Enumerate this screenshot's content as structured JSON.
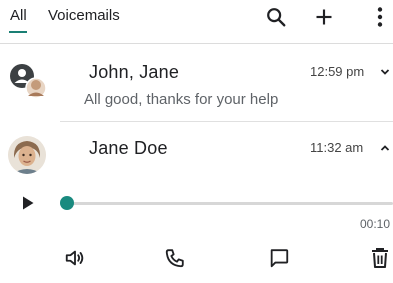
{
  "tabs": [
    {
      "label": "All",
      "selected": true
    },
    {
      "label": "Voicemails",
      "selected": false
    }
  ],
  "toolbar": {
    "icons": [
      "search-icon",
      "add-icon",
      "more-vert-icon"
    ]
  },
  "conversations": [
    {
      "name": "John, Jane",
      "time": "12:59 pm",
      "preview": "All good, thanks for your help",
      "expanded": false,
      "avatar": "group-avatar"
    },
    {
      "name": "Jane Doe",
      "time": "11:32 am",
      "expanded": true,
      "avatar": "contact-photo",
      "voicemail": {
        "progress": 0.0,
        "duration": "00:10"
      }
    }
  ],
  "actions": [
    "speaker-icon",
    "phone-icon",
    "message-icon",
    "delete-icon"
  ],
  "colors": {
    "accent": "#1a8a7f",
    "text": "#202124",
    "secondary": "#5f6368",
    "divider": "#dcdcdc"
  }
}
